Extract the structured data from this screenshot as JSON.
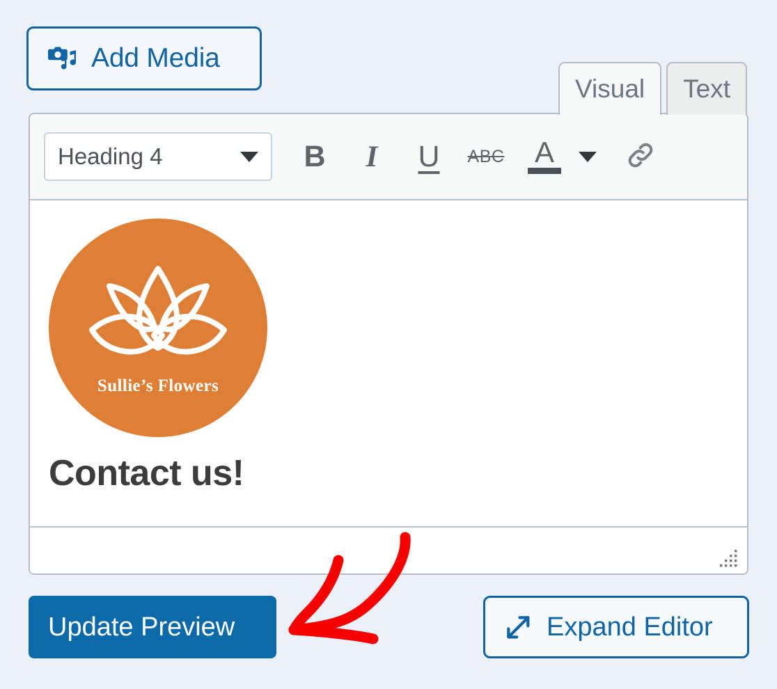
{
  "page": {
    "background_color": "#eaf1fa",
    "accent_blue": "#1064a4",
    "button_blue": "#0c6aab",
    "brand_orange": "#df7e35",
    "annotation_color": "#f60000"
  },
  "toolbar_top": {
    "add_media": {
      "label": "Add Media",
      "icon": "camera-music-icon"
    }
  },
  "tabs": [
    {
      "label": "Visual",
      "state": "active"
    },
    {
      "label": "Text",
      "state": "inactive"
    }
  ],
  "editor": {
    "toolbar": {
      "format_select": {
        "value": "Heading 4",
        "caret_icon": "chevron-down-icon"
      },
      "buttons": [
        {
          "name": "bold",
          "glyph": "B",
          "icon": "bold-icon"
        },
        {
          "name": "italic",
          "glyph": "I",
          "icon": "italic-icon"
        },
        {
          "name": "underline",
          "glyph": "U",
          "icon": "underline-icon"
        },
        {
          "name": "strikethrough",
          "glyph": "ABC",
          "icon": "strikethrough-icon"
        },
        {
          "name": "text-color",
          "glyph": "A",
          "icon": "text-color-icon"
        },
        {
          "name": "text-color-menu",
          "glyph": "",
          "icon": "chevron-down-icon"
        },
        {
          "name": "insert-link",
          "glyph": "",
          "icon": "link-icon"
        }
      ]
    },
    "content": {
      "logo": {
        "alt": "Sullie's Flowers",
        "caption": "Sullie’s Flowers",
        "background": "#df7e35"
      },
      "heading": "Contact us!"
    },
    "statusbar": {
      "resize_handle_icon": "resize-grip-icon"
    }
  },
  "actions": {
    "update_preview": {
      "label": "Update Preview"
    },
    "expand_editor": {
      "label": "Expand Editor",
      "icon": "expand-arrows-icon"
    }
  },
  "annotation": {
    "type": "hand-drawn-arrow",
    "points_to": "Update Preview"
  }
}
